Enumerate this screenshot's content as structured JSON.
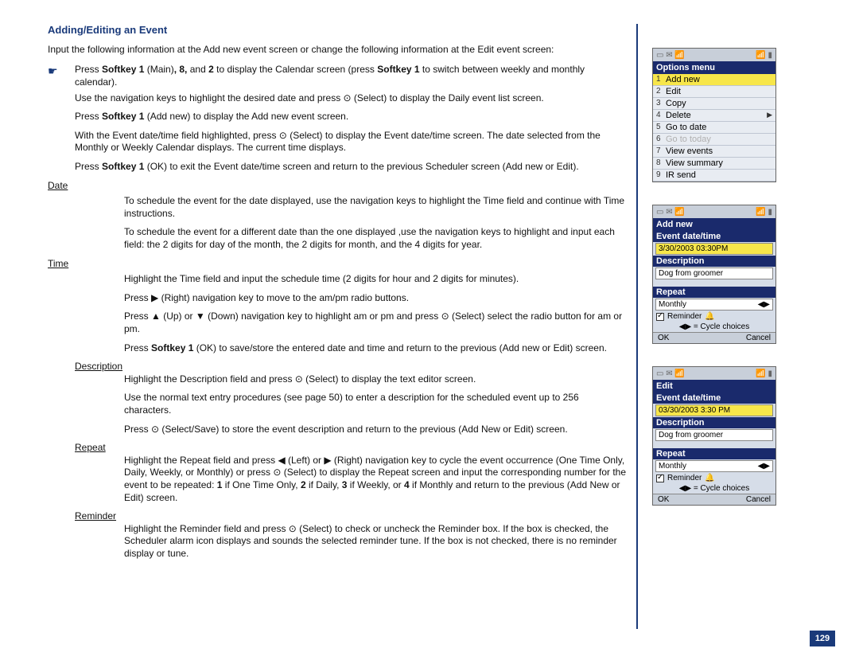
{
  "heading": "Adding/Editing an Event",
  "intro": "Input the following information at the Add new event screen or change the following information at the Edit event screen:",
  "main_bullet": {
    "pre": "Press ",
    "sk1": "Softkey 1",
    "mid1": " (Main)",
    "bold8": ", 8,",
    "mid2": " and ",
    "bold2": "2",
    "mid3": " to display the Calendar screen (press ",
    "sk1b": "Softkey 1",
    "tail": " to switch between weekly and monthly calendar)."
  },
  "steps": {
    "nav": "Use the navigation keys to highlight the desired date and press ⊙ (Select) to display the Daily event list screen.",
    "addnew_pre": "Press ",
    "addnew_b": "Softkey 1",
    "addnew_post": " (Add new) to display the Add new event screen.",
    "datetime": "With the Event date/time field highlighted, press ⊙ (Select) to display the Event date/time screen. The date selected from the Monthly or Weekly Calendar displays. The current time displays.",
    "ok_pre": "Press ",
    "ok_b": "Softkey 1",
    "ok_post": " (OK) to exit the Event date/time screen and return to the previous Scheduler screen (Add new or Edit)."
  },
  "labels": {
    "date": "Date",
    "time": "Time",
    "description": "Description",
    "repeat": "Repeat",
    "reminder": "Reminder"
  },
  "date": {
    "l1": "To schedule the event for the date displayed, use the navigation keys to highlight the Time field and continue with Time instructions.",
    "l2": "To schedule the event for a different date than the one displayed ,use the navigation keys to highlight and input each field: the 2 digits for day of the month, the 2 digits for month, and the 4 digits for year."
  },
  "time": {
    "l1": "Highlight the Time field and input the schedule time (2 digits for hour and 2 digits for minutes).",
    "l2": "Press ▶ (Right) navigation key to move to the am/pm radio buttons.",
    "l3": "Press ▲ (Up) or ▼ (Down) navigation key to highlight am or pm and press ⊙ (Select) select the radio button for am or pm.",
    "l4_pre": "Press ",
    "l4_b": "Softkey 1",
    "l4_post": " (OK) to save/store the entered date and time and return to the previous (Add new or Edit) screen."
  },
  "description": {
    "l1": "Highlight the Description field and press ⊙ (Select) to display the text editor screen.",
    "l2": "Use the normal text entry procedures (see page 50) to enter a description for the scheduled event up to 256 characters.",
    "l3": "Press ⊙ (Select/Save) to store the event description and return to the previous (Add New or Edit) screen."
  },
  "repeat": {
    "l1_a": "Highlight the Repeat field and press ◀ (Left) or ▶ (Right) navigation key to cycle the event occurrence (One Time Only, Daily, Weekly, or Monthly) or press ⊙ (Select) to display the Repeat screen and input the corresponding number for the event to be repeated: ",
    "b1": "1",
    "t1": " if One Time Only, ",
    "b2": "2",
    "t2": " if Daily, ",
    "b3": "3",
    "t3": " if Weekly, or ",
    "b4": "4",
    "t4": " if Monthly and return to the previous (Add New or Edit) screen."
  },
  "reminder": {
    "l1": "Highlight the Reminder field and press ⊙ (Select) to check or uncheck the Reminder box. If the box is checked, the Scheduler alarm icon displays and sounds the selected reminder tune. If the box is not checked, there is no reminder display or tune."
  },
  "page_number": "129",
  "phone1": {
    "title": "Options menu",
    "items": [
      {
        "n": "1",
        "t": "Add new",
        "hl": true
      },
      {
        "n": "2",
        "t": "Edit"
      },
      {
        "n": "3",
        "t": "Copy"
      },
      {
        "n": "4",
        "t": "Delete",
        "arrow": true
      },
      {
        "n": "5",
        "t": "Go to date"
      },
      {
        "n": "6",
        "t": "Go to today",
        "dim": true
      },
      {
        "n": "7",
        "t": "View events"
      },
      {
        "n": "8",
        "t": "View summary"
      },
      {
        "n": "9",
        "t": "IR send"
      }
    ]
  },
  "phone2": {
    "title": "Add new",
    "evt_label": "Event date/time",
    "evt_value": "3/30/2003 03:30PM",
    "desc_label": "Description",
    "desc_value": "Dog from groomer",
    "repeat_label": "Repeat",
    "repeat_value": "Monthly",
    "reminder": "Reminder",
    "cycle": "◀▶ = Cycle choices",
    "ok": "OK",
    "cancel": "Cancel"
  },
  "phone3": {
    "title": "Edit",
    "evt_label": "Event date/time",
    "evt_value": "03/30/2003 3:30 PM",
    "desc_label": "Description",
    "desc_value": "Dog from groomer",
    "repeat_label": "Repeat",
    "repeat_value": "Monthly",
    "reminder": "Reminder",
    "cycle": "◀▶ = Cycle choices",
    "ok": "OK",
    "cancel": "Cancel"
  }
}
